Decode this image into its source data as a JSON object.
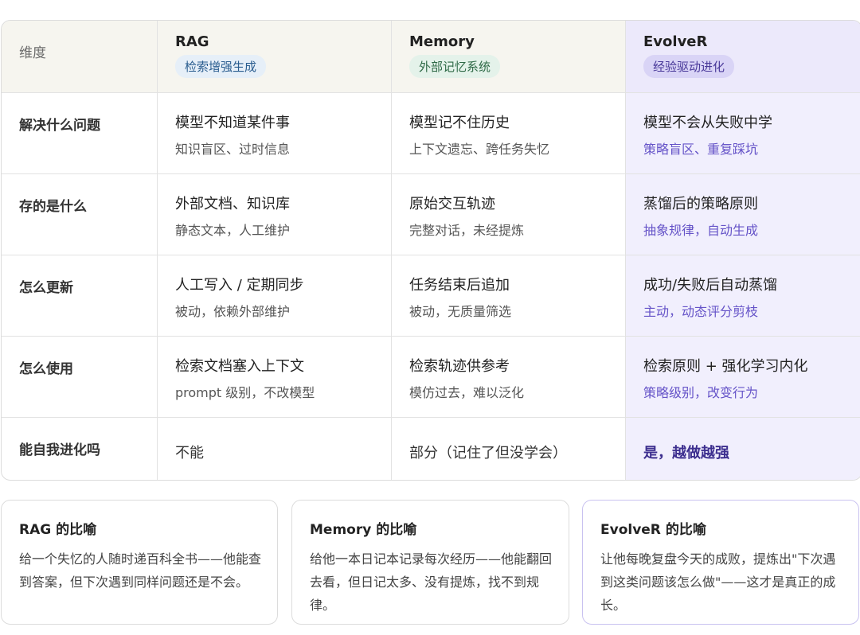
{
  "table": {
    "header": {
      "dimension": "维度",
      "columns": [
        {
          "title": "RAG",
          "badge": "检索增强生成"
        },
        {
          "title": "Memory",
          "badge": "外部记忆系统"
        },
        {
          "title": "EvolveR",
          "badge": "经验驱动进化"
        }
      ]
    },
    "rows": [
      {
        "label": "解决什么问题",
        "cells": [
          {
            "main": "模型不知道某件事",
            "sub": "知识盲区、过时信息"
          },
          {
            "main": "模型记不住历史",
            "sub": "上下文遗忘、跨任务失忆"
          },
          {
            "main": "模型不会从失败中学",
            "sub": "策略盲区、重复踩坑"
          }
        ]
      },
      {
        "label": "存的是什么",
        "cells": [
          {
            "main": "外部文档、知识库",
            "sub": "静态文本，人工维护"
          },
          {
            "main": "原始交互轨迹",
            "sub": "完整对话，未经提炼"
          },
          {
            "main": "蒸馏后的策略原则",
            "sub": "抽象规律，自动生成"
          }
        ]
      },
      {
        "label": "怎么更新",
        "cells": [
          {
            "main": "人工写入 / 定期同步",
            "sub": "被动，依赖外部维护"
          },
          {
            "main": "任务结束后追加",
            "sub": "被动，无质量筛选"
          },
          {
            "main": "成功/失败后自动蒸馏",
            "sub": "主动，动态评分剪枝"
          }
        ]
      },
      {
        "label": "怎么使用",
        "cells": [
          {
            "main": "检索文档塞入上下文",
            "sub": "prompt 级别，不改模型"
          },
          {
            "main": "检索轨迹供参考",
            "sub": "模仿过去，难以泛化"
          },
          {
            "main": "检索原则 + 强化学习内化",
            "sub": "策略级别，改变行为"
          }
        ]
      },
      {
        "label": "能自我进化吗",
        "cells": [
          {
            "main": "不能"
          },
          {
            "main": "部分（记住了但没学会）"
          },
          {
            "main": "是，越做越强"
          }
        ]
      }
    ]
  },
  "cards": [
    {
      "title": "RAG 的比喻",
      "text": "给一个失忆的人随时递百科全书——他能查到答案，但下次遇到同样问题还是不会。"
    },
    {
      "title": "Memory 的比喻",
      "text": "给他一本日记本记录每次经历——他能翻回去看，但日记太多、没有提炼，找不到规律。"
    },
    {
      "title": "EvolveR 的比喻",
      "text": "让他每晚复盘今天的成败，提炼出\"下次遇到这类问题该怎么做\"——这才是真正的成长。"
    }
  ]
}
